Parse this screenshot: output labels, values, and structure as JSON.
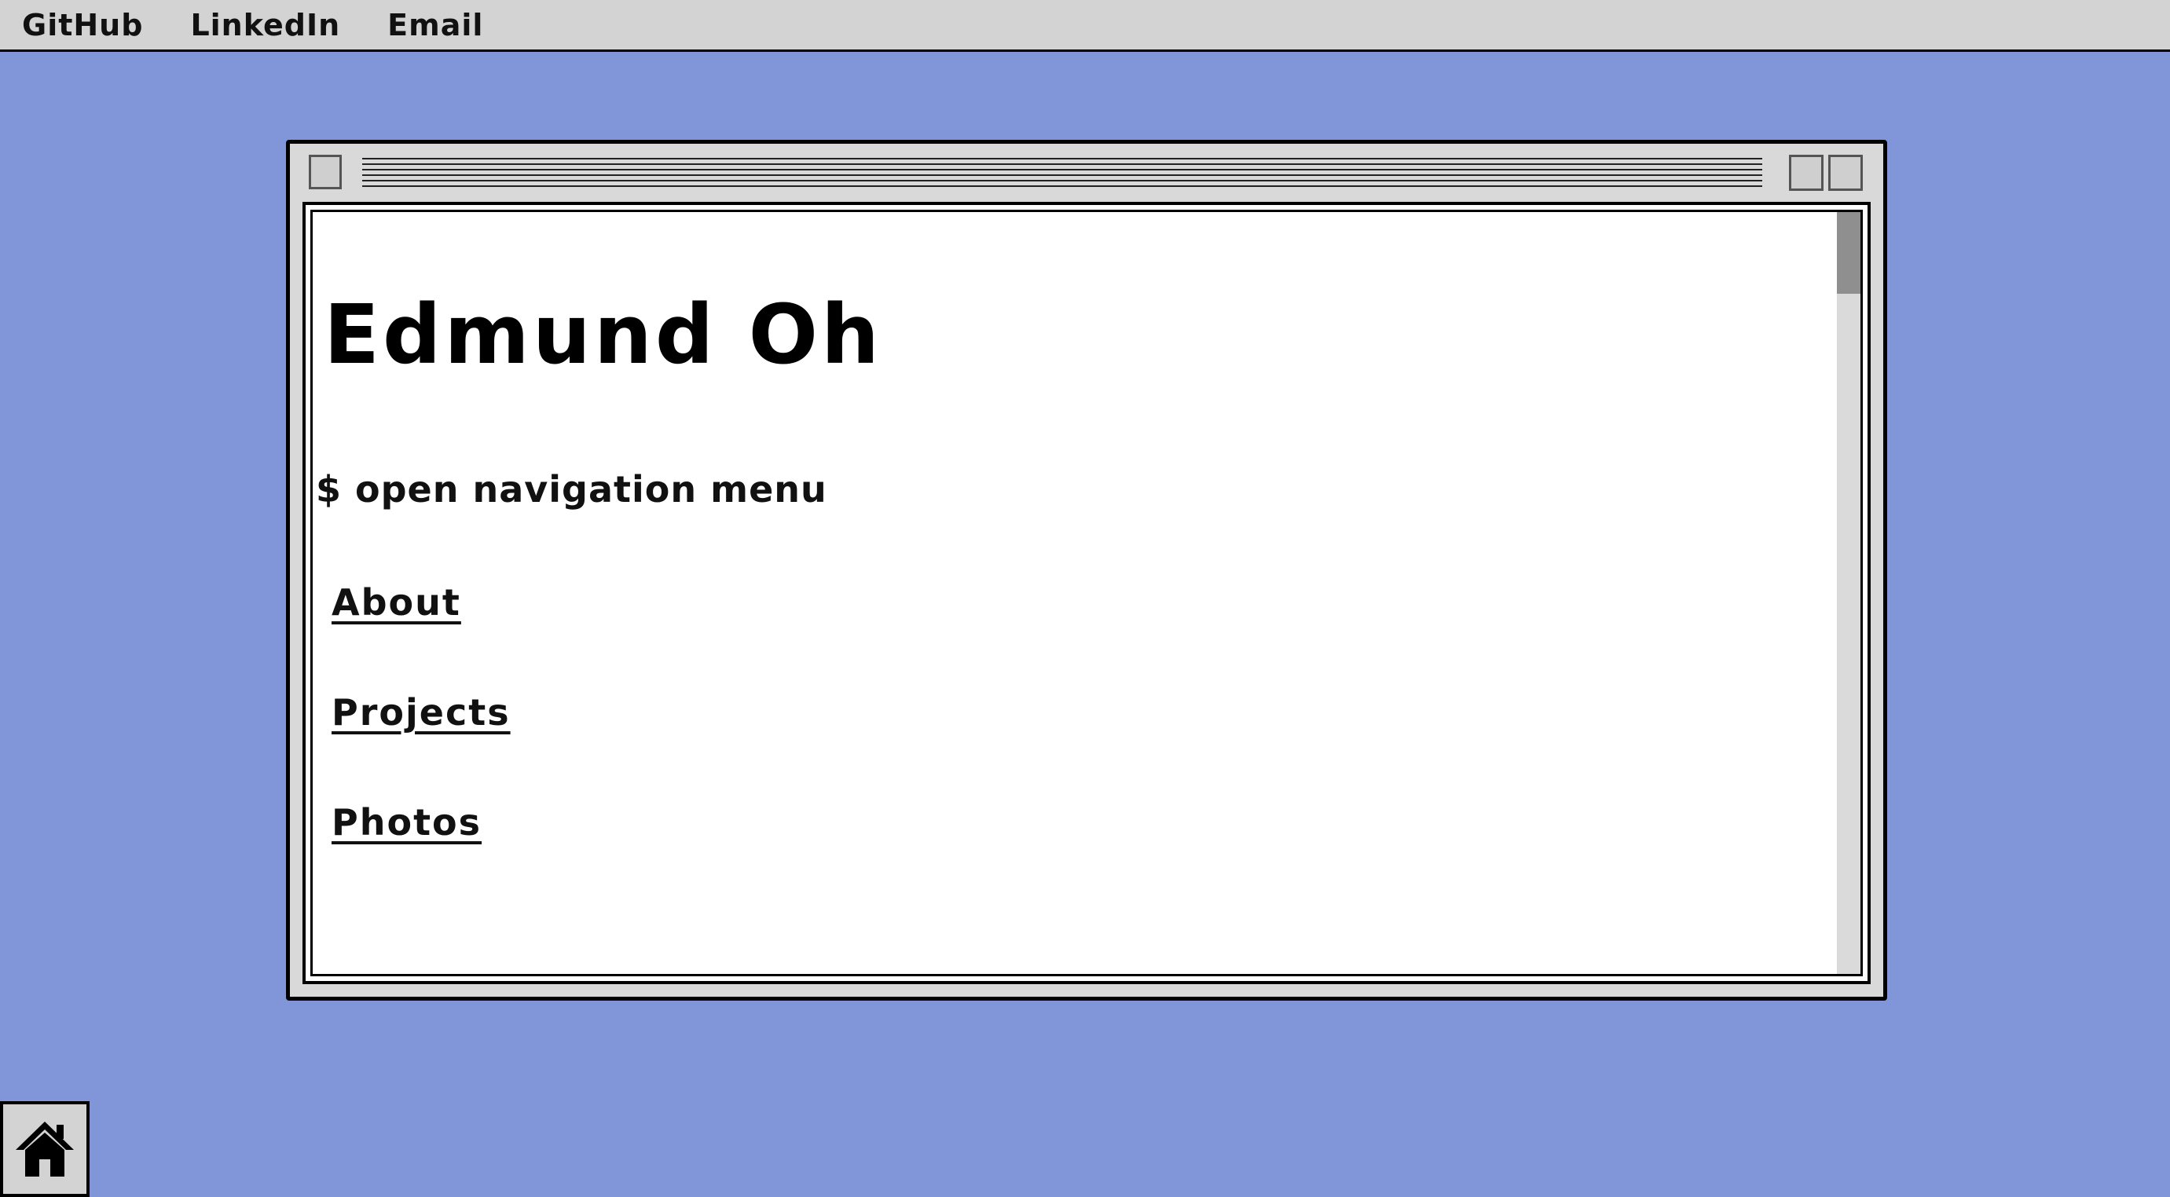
{
  "menubar": {
    "items": [
      {
        "label": "GitHub"
      },
      {
        "label": "LinkedIn"
      },
      {
        "label": "Email"
      }
    ]
  },
  "window": {
    "heading": "Edmund Oh",
    "prompt": "$ open navigation menu",
    "links": [
      {
        "label": "About"
      },
      {
        "label": "Projects"
      },
      {
        "label": "Photos"
      }
    ]
  },
  "colors": {
    "desktop_background": "#8096d8",
    "menubar_background": "#d3d3d3",
    "window_chrome": "#d9d9d9"
  },
  "icons": {
    "home_button": "home-icon"
  }
}
